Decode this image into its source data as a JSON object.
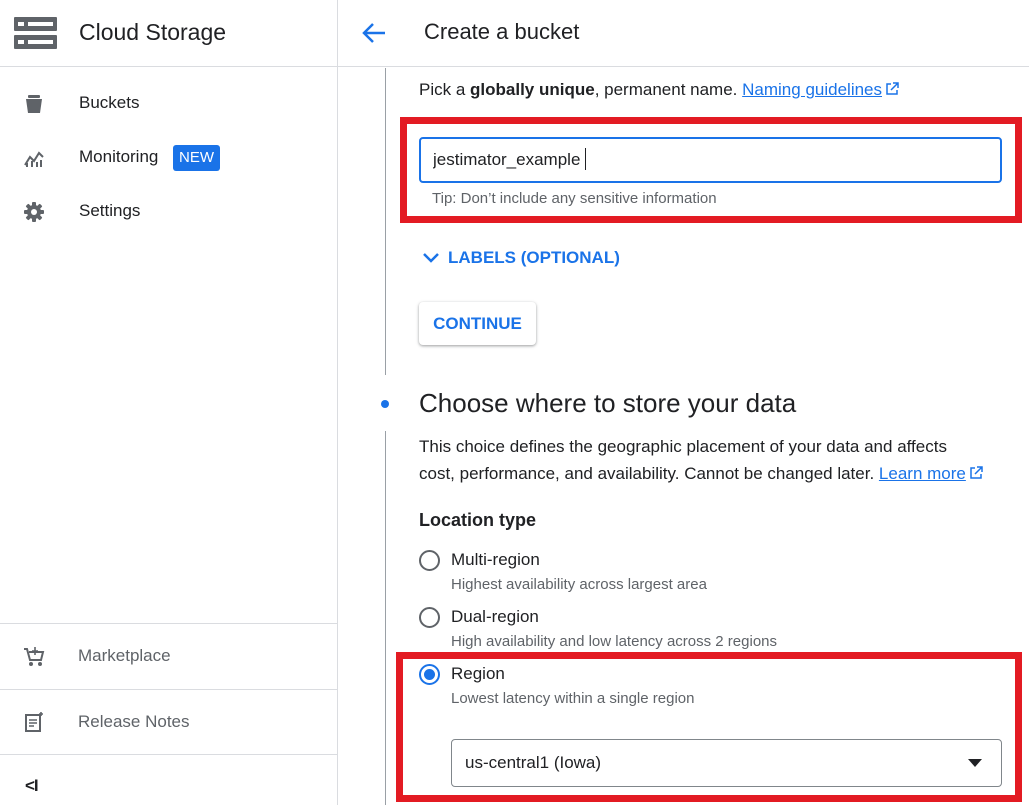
{
  "sidebar": {
    "title": "Cloud Storage",
    "logo_icon": "storage-icon",
    "items": [
      {
        "label": "Buckets",
        "icon": "bucket-icon"
      },
      {
        "label": "Monitoring",
        "icon": "monitoring-chart-icon",
        "badge": "NEW"
      },
      {
        "label": "Settings",
        "icon": "gear-icon"
      }
    ],
    "bottom_items": [
      {
        "label": "Marketplace",
        "icon": "cart-icon"
      },
      {
        "label": "Release Notes",
        "icon": "notes-icon"
      }
    ],
    "collapse_label": "<I"
  },
  "header": {
    "title": "Create a bucket",
    "back_icon": "arrow-back-icon"
  },
  "name_section": {
    "hint_pre": "Pick a ",
    "hint_bold": "globally unique",
    "hint_post": ", permanent name.",
    "guidelines_link": "Naming guidelines",
    "input_value": "jestimator_example",
    "tip": "Tip: Don’t include any sensitive information",
    "labels_toggle": "LABELS (OPTIONAL)",
    "continue_label": "CONTINUE"
  },
  "location_section": {
    "title": "Choose where to store your data",
    "desc_line1": "This choice defines the geographic placement of your data and affects",
    "desc_line2": "cost, performance, and availability. Cannot be changed later.",
    "learn_more": "Learn more",
    "location_type_label": "Location type",
    "options": [
      {
        "label": "Multi-region",
        "sub": "Highest availability across largest area",
        "checked": false
      },
      {
        "label": "Dual-region",
        "sub": "High availability and low latency across 2 regions",
        "checked": false
      },
      {
        "label": "Region",
        "sub": "Lowest latency within a single region",
        "checked": true
      }
    ],
    "region_value": "us-central1 (Iowa)"
  },
  "colors": {
    "accent": "#1a73e8",
    "highlight": "#e31b23",
    "border": "#dadce0"
  }
}
